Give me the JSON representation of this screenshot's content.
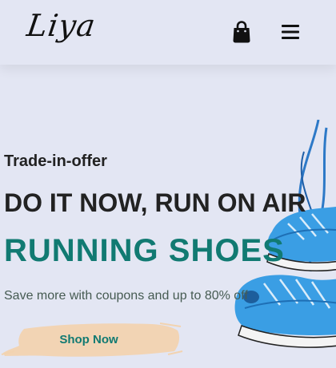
{
  "header": {
    "logo_text": "Liya",
    "bag_icon": "shopping-bag-icon",
    "menu_icon": "hamburger-menu-icon"
  },
  "hero": {
    "subtitle": "Trade-in-offer",
    "headline": "DO IT NOW, RUN ON AIR",
    "headline_accent": "RUNNING SHOES",
    "description": "Save more with coupons and up to 80% off",
    "cta_label": "Shop Now",
    "image": "running-shoes-image"
  },
  "colors": {
    "background": "#e3e6f3",
    "accent": "#117a72",
    "text_dark": "#222222",
    "button_bg": "#f2d3b0"
  }
}
